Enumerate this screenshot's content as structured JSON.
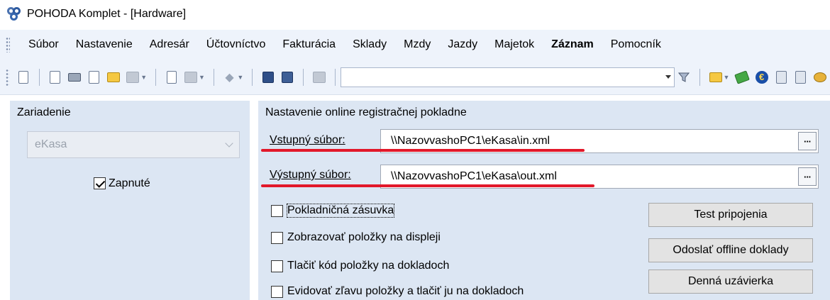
{
  "window": {
    "title": "POHODA Komplet - [Hardware]"
  },
  "menu": {
    "items": [
      {
        "label": "Súbor",
        "bold": false
      },
      {
        "label": "Nastavenie",
        "bold": false
      },
      {
        "label": "Adresár",
        "bold": false
      },
      {
        "label": "Účtovníctvo",
        "bold": false
      },
      {
        "label": "Fakturácia",
        "bold": false
      },
      {
        "label": "Sklady",
        "bold": false
      },
      {
        "label": "Mzdy",
        "bold": false
      },
      {
        "label": "Jazdy",
        "bold": false
      },
      {
        "label": "Majetok",
        "bold": false
      },
      {
        "label": "Záznam",
        "bold": true
      },
      {
        "label": "Pomocník",
        "bold": false
      }
    ]
  },
  "toolbar": {
    "combo_value": "",
    "euro_glyph": "€",
    "ellipsis_glyph": "···"
  },
  "device": {
    "group_label": "Zariadenie",
    "select_value": "eKasa",
    "enabled_label": "Zapnuté",
    "enabled_checked": true
  },
  "online": {
    "group_label": "Nastavenie online registračnej pokladne",
    "input_label": "Vstupný súbor:",
    "input_value": "\\\\NazovvashoPC1\\eKasa\\in.xml",
    "output_label": "Výstupný súbor:",
    "output_value": "\\\\NazovvashoPC1\\eKasa\\out.xml",
    "options": [
      {
        "label": "Pokladničná zásuvka",
        "checked": false
      },
      {
        "label": "Zobrazovať položky na displeji",
        "checked": false
      },
      {
        "label": "Tlačiť kód položky na dokladoch",
        "checked": false
      },
      {
        "label": "Evidovať zľavu položky a tlačiť ju na dokladoch",
        "checked": false
      }
    ],
    "buttons": {
      "test": "Test pripojenia",
      "offline": "Odoslať offline doklady",
      "closing": "Denná uzávierka"
    }
  },
  "colors": {
    "highlight_line": "#e2182a",
    "panel_bg": "#dce6f3",
    "menubar_bg": "#eef3fb"
  }
}
